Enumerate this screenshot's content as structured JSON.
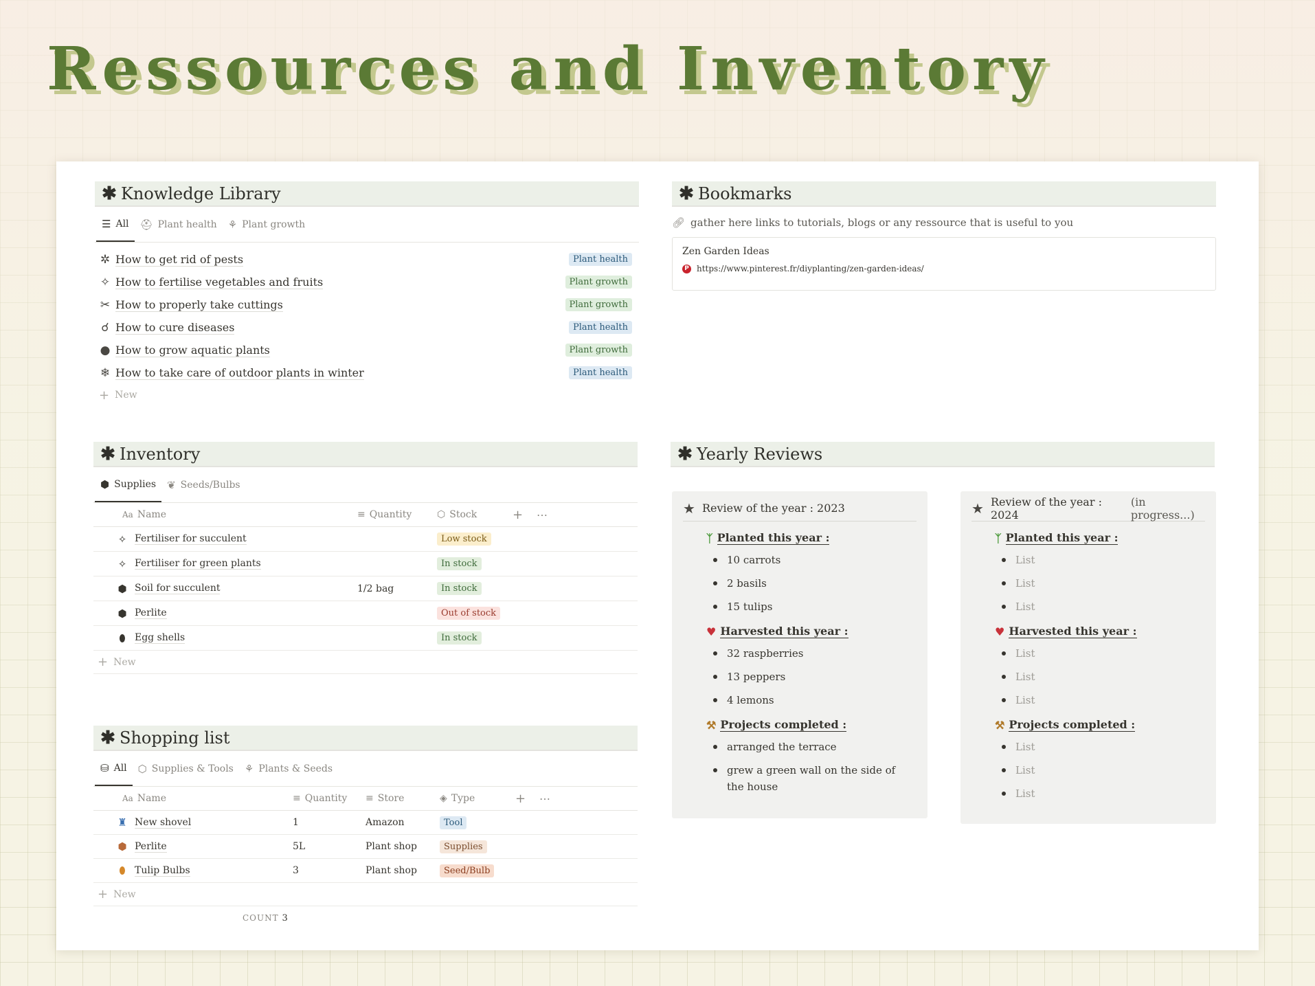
{
  "page": {
    "title": "Ressources and Inventory"
  },
  "knowledge": {
    "header": "Knowledge Library",
    "tabs": [
      {
        "label": "All",
        "icon": "list-icon"
      },
      {
        "label": "Plant health",
        "icon": "first-aid-icon"
      },
      {
        "label": "Plant growth",
        "icon": "plant-icon"
      }
    ],
    "items": [
      {
        "icon": "bug-icon",
        "title": "How to get rid of pests",
        "tag": "Plant health"
      },
      {
        "icon": "sparkle-icon",
        "title": "How to fertilise vegetables and fruits",
        "tag": "Plant growth"
      },
      {
        "icon": "scissors-icon",
        "title": "How to properly take cuttings",
        "tag": "Plant growth"
      },
      {
        "icon": "stethoscope-icon",
        "title": "How to cure diseases",
        "tag": "Plant health"
      },
      {
        "icon": "drop-icon",
        "title": "How to grow aquatic plants",
        "tag": "Plant growth"
      },
      {
        "icon": "snowflake-icon",
        "title": "How to take care of outdoor plants in winter",
        "tag": "Plant health"
      }
    ],
    "new_label": "New"
  },
  "bookmarks": {
    "header": "Bookmarks",
    "description": "gather here links to tutorials, blogs or any ressource that is useful to you",
    "item": {
      "title": "Zen Garden Ideas",
      "url": "https://www.pinterest.fr/diyplanting/zen-garden-ideas/",
      "icon": "pinterest-icon"
    }
  },
  "inventory": {
    "header": "Inventory",
    "tabs": [
      {
        "label": "Supplies",
        "icon": "box-icon"
      },
      {
        "label": "Seeds/Bulbs",
        "icon": "leaf-icon"
      }
    ],
    "columns": {
      "name": "Name",
      "quantity": "Quantity",
      "stock": "Stock"
    },
    "rows": [
      {
        "icon": "sparkle-icon",
        "name": "Fertiliser for succulent",
        "quantity": "",
        "stock": "Low stock"
      },
      {
        "icon": "sparkle-icon",
        "name": "Fertiliser for green plants",
        "quantity": "",
        "stock": "In stock"
      },
      {
        "icon": "box-icon",
        "name": "Soil for succulent",
        "quantity": "1/2 bag",
        "stock": "In stock"
      },
      {
        "icon": "box-icon",
        "name": "Perlite",
        "quantity": "",
        "stock": "Out of stock"
      },
      {
        "icon": "egg-icon",
        "name": "Egg shells",
        "quantity": "",
        "stock": "In stock"
      }
    ],
    "new_label": "New"
  },
  "shopping": {
    "header": "Shopping list",
    "tabs": [
      {
        "label": "All",
        "icon": "basket-icon"
      },
      {
        "label": "Supplies & Tools",
        "icon": "box-icon"
      },
      {
        "label": "Plants & Seeds",
        "icon": "plant-icon"
      }
    ],
    "columns": {
      "name": "Name",
      "quantity": "Quantity",
      "store": "Store",
      "type": "Type"
    },
    "rows": [
      {
        "icon": "shovel-icon",
        "name": "New shovel",
        "quantity": "1",
        "store": "Amazon",
        "type": "Tool"
      },
      {
        "icon": "package-icon",
        "name": "Perlite",
        "quantity": "5L",
        "store": "Plant shop",
        "type": "Supplies"
      },
      {
        "icon": "seed-icon",
        "name": "Tulip Bulbs",
        "quantity": "3",
        "store": "Plant shop",
        "type": "Seed/Bulb"
      }
    ],
    "new_label": "New",
    "count_label": "COUNT",
    "count_value": "3"
  },
  "reviews": {
    "header": "Yearly Reviews",
    "y2023": {
      "title": "Review of the year : 2023",
      "planted_label": "Planted this year :",
      "planted": [
        "10 carrots",
        "2 basils",
        "15 tulips"
      ],
      "harvested_label": "Harvested this year :",
      "harvested": [
        "32 raspberries",
        "13 peppers",
        "4 lemons"
      ],
      "projects_label": "Projects completed :",
      "projects": [
        "arranged the terrace",
        "grew a green wall on the side of the house"
      ]
    },
    "y2024": {
      "title": "Review of the year : 2024",
      "progress": "(in progress...)",
      "planted_label": "Planted this year :",
      "planted": [
        "List",
        "List",
        "List"
      ],
      "harvested_label": "Harvested this year :",
      "harvested": [
        "List",
        "List",
        "List"
      ],
      "projects_label": "Projects completed :",
      "projects": [
        "List",
        "List",
        "List"
      ]
    }
  }
}
